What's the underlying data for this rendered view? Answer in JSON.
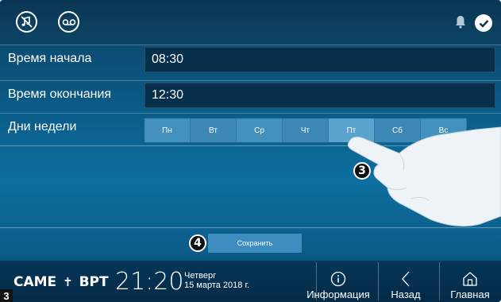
{
  "topbar": {
    "icons": [
      "mute-ring-icon",
      "voicemail-icon",
      "bell-icon",
      "check-icon"
    ]
  },
  "form": {
    "start_label": "Время начала",
    "start_value": "08:30",
    "end_label": "Время окончания",
    "end_value": "12:30",
    "days_label": "Дни недели",
    "days": [
      "Пн",
      "Вт",
      "Ср",
      "Чт",
      "Пт",
      "Сб",
      "Вс"
    ],
    "selected_day": "Пт"
  },
  "save_label": "Сохранить",
  "callouts": {
    "hand_step": "3",
    "save_step": "4"
  },
  "status": {
    "brand_came": "CAME",
    "brand_bpt": "BPT",
    "time": "21:20",
    "weekday": "Четверг",
    "date": "15 марта 2018 г."
  },
  "nav": {
    "info": "Информация",
    "back": "Назад",
    "home": "Главная"
  },
  "page_number": "3"
}
